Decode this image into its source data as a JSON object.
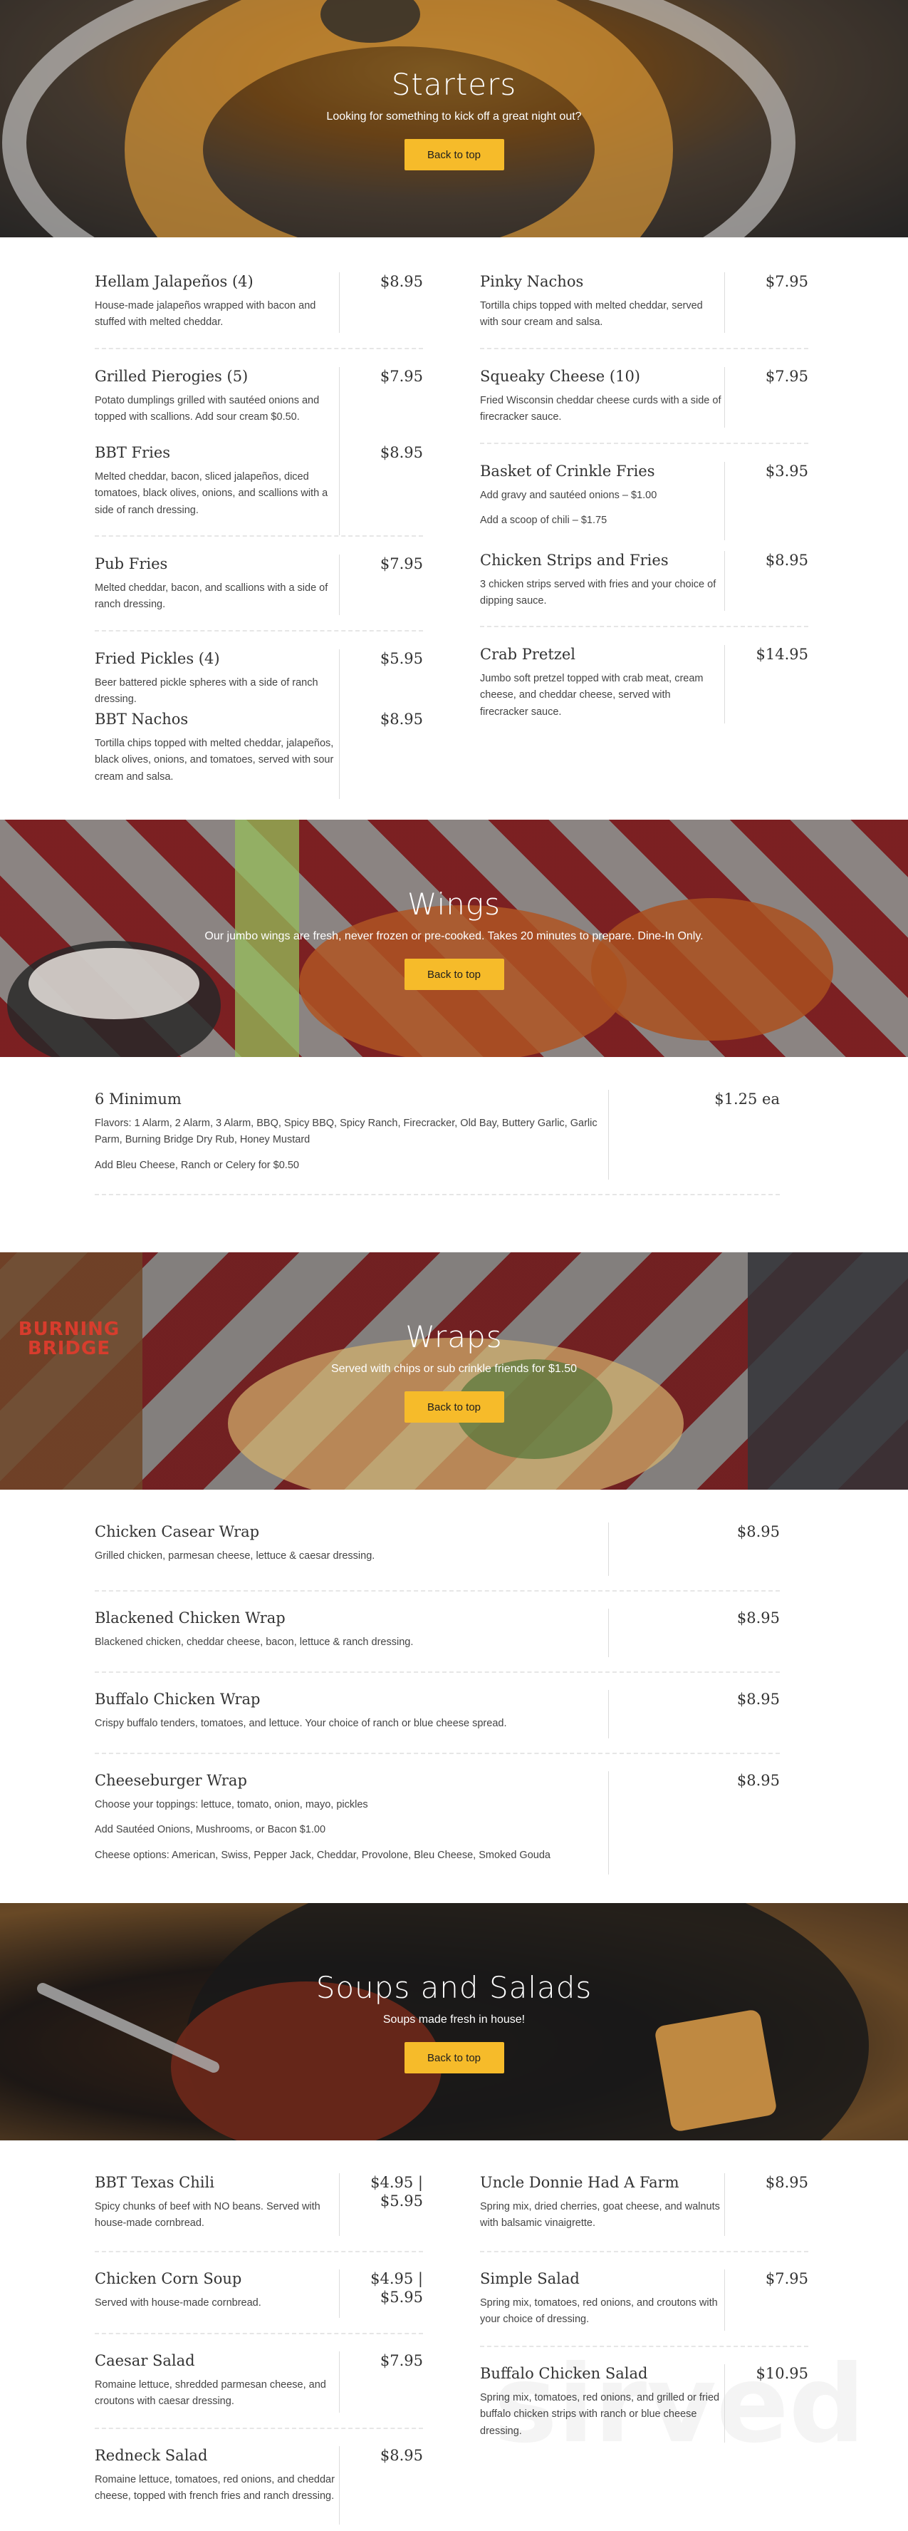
{
  "sections": {
    "starters": {
      "title": "Starters",
      "subtitle": "Looking for something to kick off a great night out?",
      "back_label": "Back to top",
      "left": [
        {
          "name": "Hellam Jalapeños (4)",
          "price": "$8.95",
          "desc": [
            "House-made jalapeños wrapped with bacon and stuffed with melted cheddar."
          ]
        },
        {
          "name": "Grilled Pierogies (5)",
          "price": "$7.95",
          "desc": [
            "Potato dumplings grilled with sautéed onions and topped with scallions. Add sour cream $0.50."
          ]
        },
        {
          "name": "BBT Fries",
          "price": "$8.95",
          "desc": [
            "Melted cheddar, bacon, sliced jalapeños, diced tomatoes, black olives, onions, and scallions with a side of ranch dressing."
          ]
        },
        {
          "name": "Pub Fries",
          "price": "$7.95",
          "desc": [
            "Melted cheddar, bacon, and scallions with a side of ranch dressing."
          ]
        },
        {
          "name": "Fried Pickles (4)",
          "price": "$5.95",
          "desc": [
            "Beer battered pickle spheres with a side of ranch dressing."
          ]
        },
        {
          "name": "BBT Nachos",
          "price": "$8.95",
          "desc": [
            "Tortilla chips topped with melted cheddar, jalapeños, black olives, onions, and tomatoes, served with sour cream and salsa."
          ]
        }
      ],
      "right": [
        {
          "name": "Pinky Nachos",
          "price": "$7.95",
          "desc": [
            "Tortilla chips topped with melted cheddar, served with sour cream and salsa."
          ]
        },
        {
          "name": "Squeaky Cheese (10)",
          "price": "$7.95",
          "desc": [
            "Fried Wisconsin cheddar cheese curds with a side of firecracker sauce."
          ]
        },
        {
          "name": "Basket of Crinkle Fries",
          "price": "$3.95",
          "desc": [
            "Add gravy and sautéed onions – $1.00",
            "Add a scoop of chili – $1.75"
          ]
        },
        {
          "name": "Chicken Strips and Fries",
          "price": "$8.95",
          "desc": [
            "3 chicken strips served with fries and your choice of dipping sauce."
          ]
        },
        {
          "name": "Crab Pretzel",
          "price": "$14.95",
          "desc": [
            "Jumbo soft pretzel topped with crab meat, cream cheese, and cheddar cheese, served with firecracker sauce."
          ]
        }
      ]
    },
    "wings": {
      "title": "Wings",
      "subtitle": "Our jumbo wings are fresh, never frozen or pre-cooked. Takes 20 minutes to prepare. Dine-In Only.",
      "back_label": "Back to top",
      "items": [
        {
          "name": "6 Minimum",
          "price": "$1.25 ea",
          "desc": [
            "Flavors: 1 Alarm, 2 Alarm, 3 Alarm, BBQ, Spicy BBQ, Spicy Ranch, Firecracker, Old Bay, Buttery Garlic, Garlic Parm, Burning Bridge Dry Rub, Honey Mustard",
            "Add Bleu Cheese, Ranch or Celery for $0.50"
          ]
        }
      ]
    },
    "wraps": {
      "title": "Wraps",
      "subtitle": "Served with chips or sub crinkle friends for $1.50",
      "back_label": "Back to top",
      "logo_text": "BURNING BRIDGE",
      "items": [
        {
          "name": "Chicken Casear Wrap",
          "price": "$8.95",
          "desc": [
            "Grilled chicken, parmesan cheese, lettuce & caesar dressing."
          ]
        },
        {
          "name": "Blackened Chicken Wrap",
          "price": "$8.95",
          "desc": [
            "Blackened chicken, cheddar cheese, bacon, lettuce & ranch dressing."
          ]
        },
        {
          "name": "Buffalo Chicken Wrap",
          "price": "$8.95",
          "desc": [
            "Crispy buffalo tenders, tomatoes, and lettuce. Your choice of ranch or blue cheese spread."
          ]
        },
        {
          "name": "Cheeseburger Wrap",
          "price": "$8.95",
          "desc": [
            "Choose your toppings: lettuce, tomato, onion, mayo, pickles",
            "Add Sautéed Onions, Mushrooms, or Bacon $1.00",
            "Cheese options: American, Swiss, Pepper Jack, Cheddar, Provolone, Bleu Cheese, Smoked Gouda"
          ]
        }
      ]
    },
    "soups": {
      "title": "Soups and Salads",
      "subtitle": "Soups made fresh in house!",
      "back_label": "Back to top",
      "watermark": "sirved",
      "left": [
        {
          "name": "BBT Texas Chili",
          "price": "$4.95 | $5.95",
          "desc": [
            "Spicy chunks of beef with NO beans. Served with house-made cornbread."
          ]
        },
        {
          "name": "Chicken Corn Soup",
          "price": "$4.95 | $5.95",
          "desc": [
            "Served with house-made cornbread."
          ]
        },
        {
          "name": "Caesar Salad",
          "price": "$7.95",
          "desc": [
            "Romaine lettuce, shredded parmesan cheese, and croutons with caesar dressing."
          ]
        },
        {
          "name": "Redneck Salad",
          "price": "$8.95",
          "desc": [
            "Romaine lettuce, tomatoes, red onions, and cheddar cheese, topped with french fries and ranch dressing."
          ]
        }
      ],
      "right": [
        {
          "name": "Uncle Donnie Had A Farm",
          "price": "$8.95",
          "desc": [
            "Spring mix, dried cherries, goat cheese, and walnuts with balsamic vinaigrette."
          ]
        },
        {
          "name": "Simple Salad",
          "price": "$7.95",
          "desc": [
            "Spring mix, tomatoes, red onions, and croutons with your choice of dressing."
          ]
        },
        {
          "name": "Buffalo Chicken Salad",
          "price": "$10.95",
          "desc": [
            "Spring mix, tomatoes, red onions, and grilled or fried buffalo chicken strips with ranch or blue cheese dressing."
          ]
        }
      ]
    }
  }
}
